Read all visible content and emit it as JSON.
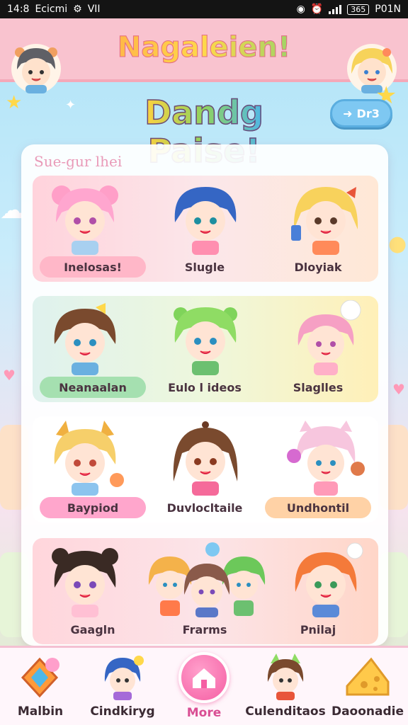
{
  "status_bar": {
    "time": "14:8",
    "left_text": "Ecicmi",
    "carrier": "VII",
    "battery": "365",
    "right_text": "P01N"
  },
  "header": {
    "title": "Nagaleien!"
  },
  "banner": {
    "title": "Dandg Paise!",
    "button_label": "Dr3"
  },
  "panel": {
    "section_title": "Sue-gur lhei",
    "rows": [
      {
        "items": [
          {
            "label": "Inelosas!"
          },
          {
            "label": "Slugle"
          },
          {
            "label": "Dloyiak"
          }
        ]
      },
      {
        "items": [
          {
            "label": "Neanaalan"
          },
          {
            "label": "Eulo l ideos"
          },
          {
            "label": "Slaglles"
          }
        ]
      },
      {
        "items": [
          {
            "label": "Baypiod"
          },
          {
            "label": "Duvlocltaile"
          },
          {
            "label": "Undhontil"
          }
        ]
      },
      {
        "items": [
          {
            "label": "Gaagln"
          },
          {
            "label": "Frarms"
          },
          {
            "label": "Pnilaj"
          }
        ]
      }
    ]
  },
  "nav": {
    "items": [
      {
        "label": "Malbin",
        "icon": "gem-frame-icon"
      },
      {
        "label": "Cindkiryg",
        "icon": "character-icon"
      },
      {
        "label": "More",
        "icon": "home-icon"
      },
      {
        "label": "Culenditaos",
        "icon": "character-icon"
      },
      {
        "label": "Daoonadie",
        "icon": "cheese-icon"
      }
    ]
  },
  "colors": {
    "header_bg": "#f9c3cf",
    "accent_pink": "#f55ea3",
    "panel_bg": "#ffffff",
    "button_blue": "#7ec8f2"
  }
}
